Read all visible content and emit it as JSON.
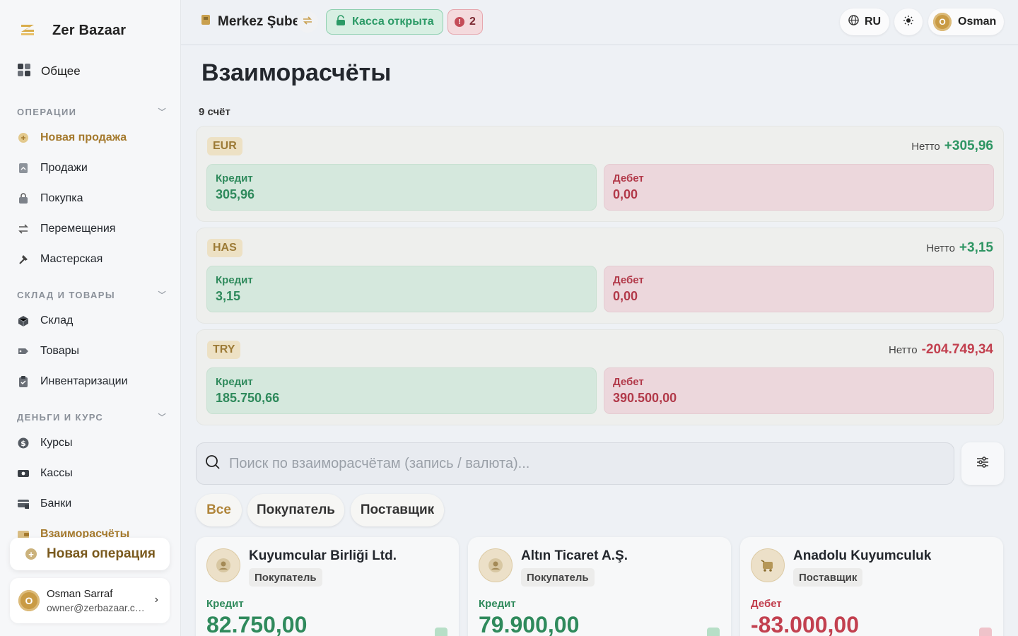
{
  "app": {
    "name": "Zer Bazaar"
  },
  "sidebar": {
    "overview": "Общее",
    "sections": [
      {
        "title": "ОПЕРАЦИИ",
        "items": [
          {
            "label": "Новая продажа",
            "icon": "plus-circle-icon"
          },
          {
            "label": "Продажи",
            "icon": "receipt-icon"
          },
          {
            "label": "Покупка",
            "icon": "bag-icon"
          },
          {
            "label": "Перемещения",
            "icon": "transfer-icon"
          },
          {
            "label": "Мастерская",
            "icon": "hammer-icon"
          }
        ]
      },
      {
        "title": "СКЛАД И ТОВАРЫ",
        "items": [
          {
            "label": "Склад",
            "icon": "box-icon"
          },
          {
            "label": "Товары",
            "icon": "tag-icon"
          },
          {
            "label": "Инвентаризации",
            "icon": "clipboard-icon"
          }
        ]
      },
      {
        "title": "ДЕНЬГИ И КУРС",
        "items": [
          {
            "label": "Курсы",
            "icon": "dollar-icon"
          },
          {
            "label": "Кассы",
            "icon": "cash-icon"
          },
          {
            "label": "Банки",
            "icon": "bank-icon"
          },
          {
            "label": "Взаиморасчёты",
            "icon": "wallet-icon"
          }
        ]
      }
    ],
    "new_operation": "Новая операция",
    "user": {
      "name": "Osman Sarraf",
      "email": "owner@zerbazaar.com",
      "initial": "O"
    }
  },
  "topbar": {
    "branch": "Merkez Şube",
    "kassa_status": "Касса открыта",
    "alerts_count": "2",
    "language": "RU",
    "user_name": "Osman",
    "user_initial": "O"
  },
  "page": {
    "title": "Взаиморасчёты",
    "count": "9 счёт",
    "net_label": "Нетто",
    "credit_label": "Кредит",
    "debit_label": "Дебет",
    "currencies": [
      {
        "code": "EUR",
        "net": "+305,96",
        "credit": "305,96",
        "debit": "0,00"
      },
      {
        "code": "HAS",
        "net": "+3,15",
        "credit": "3,15",
        "debit": "0,00"
      },
      {
        "code": "TRY",
        "net": "-204.749,34",
        "credit": "185.750,66",
        "debit": "390.500,00"
      }
    ],
    "search_placeholder": "Поиск по взаиморасчётам (запись / валюта)...",
    "filters": [
      "Все",
      "Покупатель",
      "Поставщик"
    ],
    "accounts": [
      {
        "name": "Kuyumcular Birliği Ltd.",
        "role": "Покупатель",
        "label": "Кредит",
        "amount": "82.750,00"
      },
      {
        "name": "Altın Ticaret A.Ş.",
        "role": "Покупатель",
        "label": "Кредит",
        "amount": "79.900,00"
      },
      {
        "name": "Anadolu Kuyumculuk",
        "role": "Поставщик",
        "label": "Дебет",
        "amount": "-83.000,00"
      }
    ]
  },
  "colors": {
    "accent": "#b0853a",
    "credit": "#2f8a5c",
    "debit": "#c2404f"
  }
}
